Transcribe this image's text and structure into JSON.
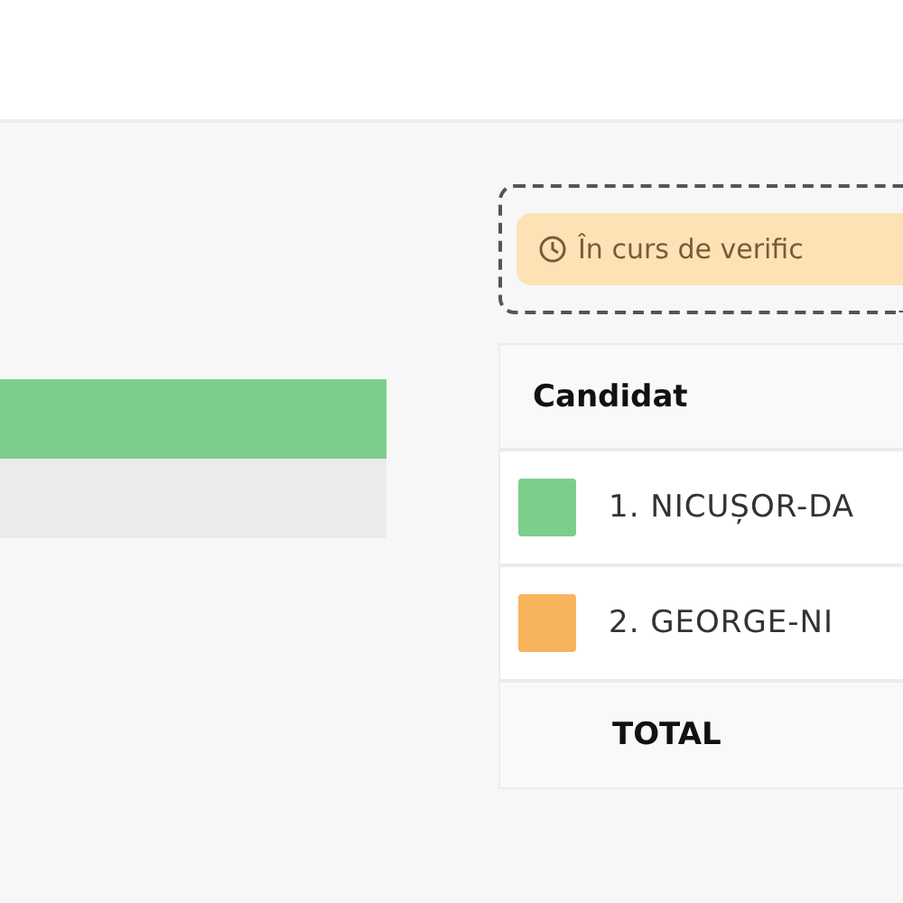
{
  "bars": [
    {
      "color": "#7bcf8b"
    },
    {
      "color": "#ececec"
    }
  ],
  "status_badge": {
    "label": "În curs de verific"
  },
  "table": {
    "columns": [
      "Candidat"
    ],
    "rows": [
      {
        "name": "1. NICUȘOR-DA",
        "color": "#7bcf8b"
      },
      {
        "name": "2. GEORGE-NI",
        "color": "#f8b45c"
      }
    ],
    "total": "TOTAL"
  }
}
